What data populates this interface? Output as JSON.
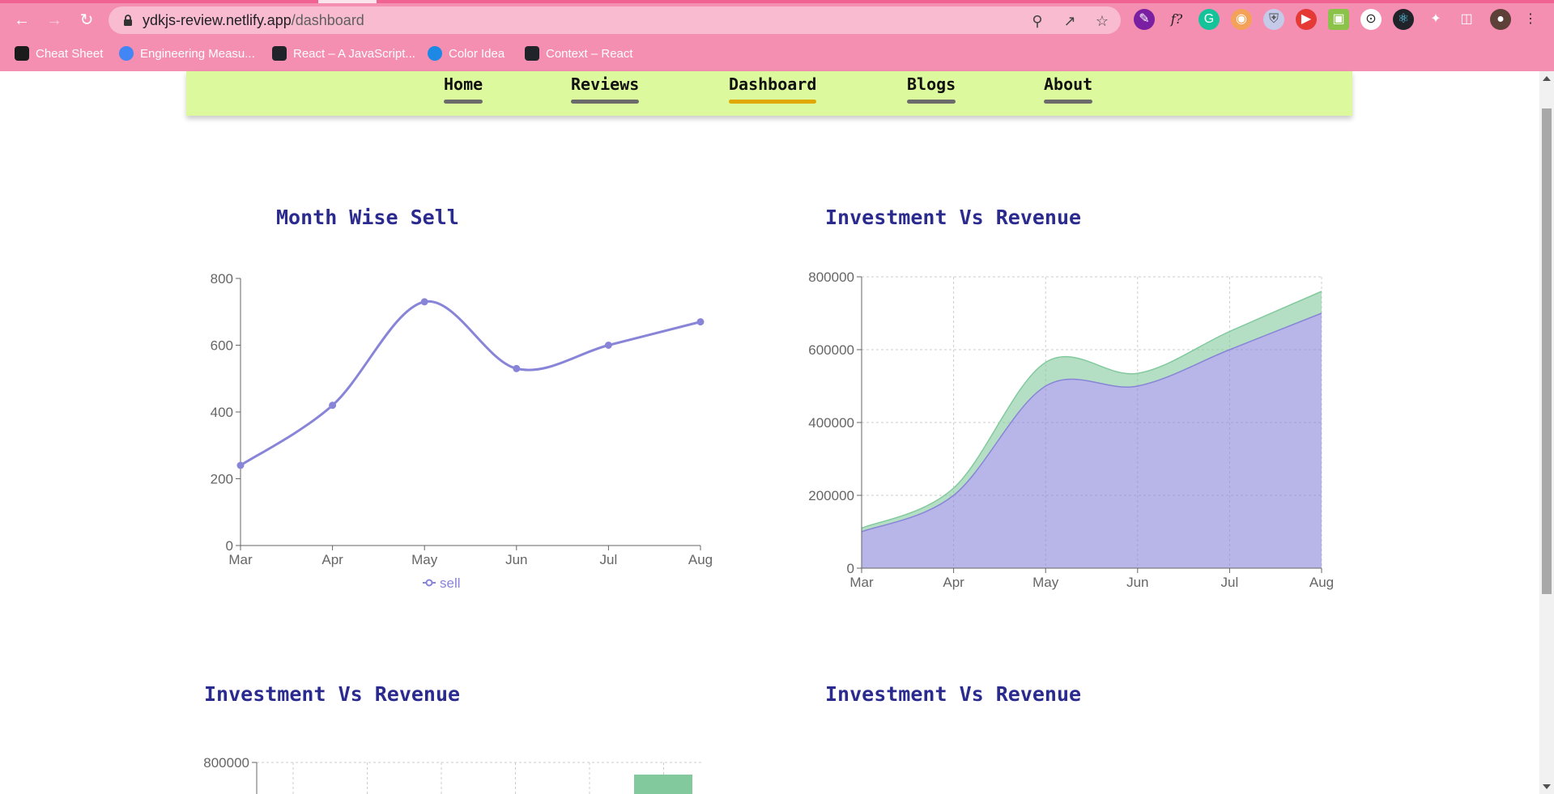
{
  "browser": {
    "url_host": "ydkjs-review.netlify.app",
    "url_path": "/dashboard",
    "bookmarks": [
      {
        "label": "Cheat Sheet",
        "icon": "vue-triangle-icon"
      },
      {
        "label": "Engineering Measu...",
        "icon": "chrome-icon"
      },
      {
        "label": "React – A JavaScript...",
        "icon": "react-icon"
      },
      {
        "label": "Color Idea",
        "icon": "color-idea-icon"
      },
      {
        "label": "Context – React",
        "icon": "react-icon"
      }
    ]
  },
  "nav": {
    "items": [
      "Home",
      "Reviews",
      "Dashboard",
      "Blogs",
      "About"
    ],
    "active": "Dashboard"
  },
  "colors": {
    "nav_bg": "#dcf99e",
    "title": "#2b2b8f",
    "line": "#8884d8",
    "area_investment": "#8884d8",
    "area_revenue": "#82ca9d",
    "active_underline": "#e0a800"
  },
  "charts": {
    "titles": [
      "Month Wise Sell",
      "Investment Vs Revenue",
      "Investment Vs Revenue",
      "Investment Vs Revenue"
    ]
  },
  "chart_data": [
    {
      "type": "line",
      "title": "Month Wise Sell",
      "categories": [
        "Mar",
        "Apr",
        "May",
        "Jun",
        "Jul",
        "Aug"
      ],
      "series": [
        {
          "name": "sell",
          "values": [
            240,
            420,
            730,
            530,
            600,
            670
          ]
        }
      ],
      "ylim": [
        0,
        800
      ],
      "yticks": [
        "0",
        "200",
        "400",
        "600",
        "800"
      ],
      "legend": "bottom"
    },
    {
      "type": "area",
      "title": "Investment Vs Revenue",
      "categories": [
        "Mar",
        "Apr",
        "May",
        "Jun",
        "Jul",
        "Aug"
      ],
      "series": [
        {
          "values": [
            100000,
            200000,
            500000,
            500000,
            600000,
            700000
          ]
        },
        {
          "values": [
            10000,
            20000,
            65000,
            35000,
            50000,
            60000
          ]
        }
      ],
      "stacked": true,
      "ylim": [
        0,
        800000
      ],
      "yticks": [
        "0",
        "200000",
        "400000",
        "600000",
        "800000"
      ],
      "grid": true
    },
    {
      "type": "bar",
      "title": "Investment Vs Revenue",
      "yticks": [
        "800000"
      ],
      "grid": true
    },
    {
      "type": "area",
      "title": "Investment Vs Revenue"
    }
  ]
}
